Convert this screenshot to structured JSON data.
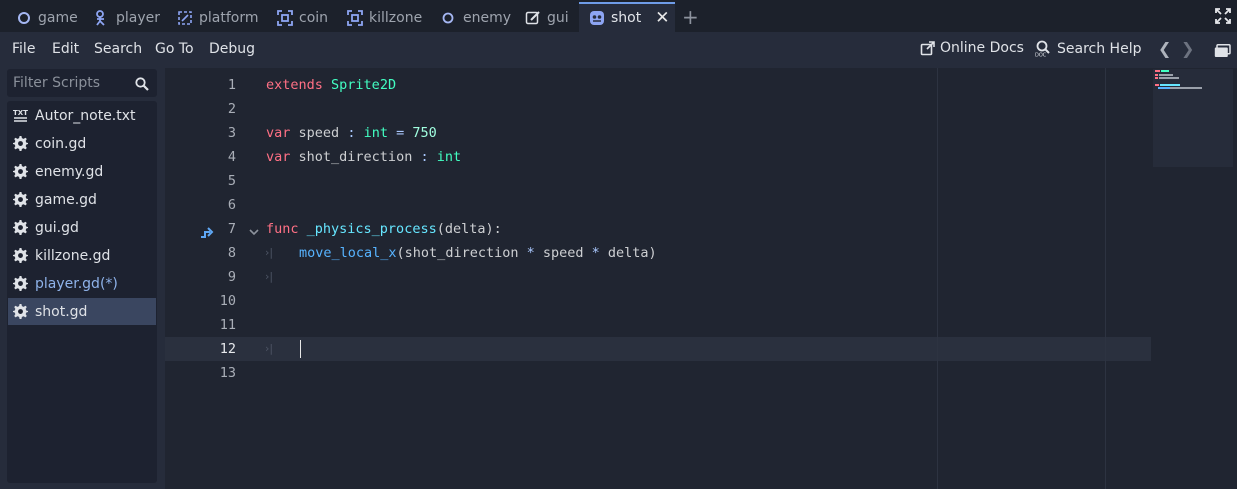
{
  "tabs": [
    {
      "label": "game",
      "icon": "node2d-circle-icon"
    },
    {
      "label": "player",
      "icon": "character-body-icon"
    },
    {
      "label": "platform",
      "icon": "animatable-body-icon"
    },
    {
      "label": "coin",
      "icon": "area2d-icon"
    },
    {
      "label": "killzone",
      "icon": "area2d-icon"
    },
    {
      "label": "enemy",
      "icon": "node2d-circle-icon"
    },
    {
      "label": "gui",
      "icon": "control-pen-icon"
    },
    {
      "label": "shot",
      "icon": "sprite2d-icon",
      "active": true
    }
  ],
  "menu": {
    "file": "File",
    "edit": "Edit",
    "search": "Search",
    "goto": "Go To",
    "debug": "Debug",
    "online_docs": "Online Docs",
    "search_help": "Search Help"
  },
  "filter": {
    "placeholder": "Filter Scripts"
  },
  "scripts": [
    {
      "label": "Autor_note.txt",
      "icon": "text-file-icon"
    },
    {
      "label": "coin.gd",
      "icon": "gear-icon"
    },
    {
      "label": "enemy.gd",
      "icon": "gear-icon"
    },
    {
      "label": "game.gd",
      "icon": "gear-icon"
    },
    {
      "label": "gui.gd",
      "icon": "gear-icon"
    },
    {
      "label": "killzone.gd",
      "icon": "gear-icon"
    },
    {
      "label": "player.gd(*)",
      "icon": "gear-icon",
      "modified": true
    },
    {
      "label": "shot.gd",
      "icon": "gear-icon",
      "selected": true
    }
  ],
  "editor": {
    "line_numbers": [
      "1",
      "2",
      "3",
      "4",
      "5",
      "6",
      "7",
      "8",
      "9",
      "10",
      "11",
      "12",
      "13"
    ],
    "code": {
      "l1_kw": "extends",
      "l1_type": "Sprite2D",
      "l3_kw": "var",
      "l3_name": "speed",
      "l3_colon": ":",
      "l3_type": "int",
      "l3_eq": "=",
      "l3_value": "750",
      "l4_kw": "var",
      "l4_name": "shot_direction",
      "l4_colon": ":",
      "l4_type": "int",
      "l7_kw": "func",
      "l7_name": "_physics_process",
      "l7_args": "(delta):",
      "l8_call": "move_local_x",
      "l8_open": "(shot_direction ",
      "l8_mul1": "*",
      "l8_mid": " speed ",
      "l8_mul2": "*",
      "l8_end": " delta)"
    },
    "current_line": "12"
  },
  "colors": {
    "keyword": "#ff7085",
    "type": "#42ffc2",
    "function": "#57b3ff",
    "number": "#a1ffe0",
    "accent": "#6f9ce7"
  }
}
